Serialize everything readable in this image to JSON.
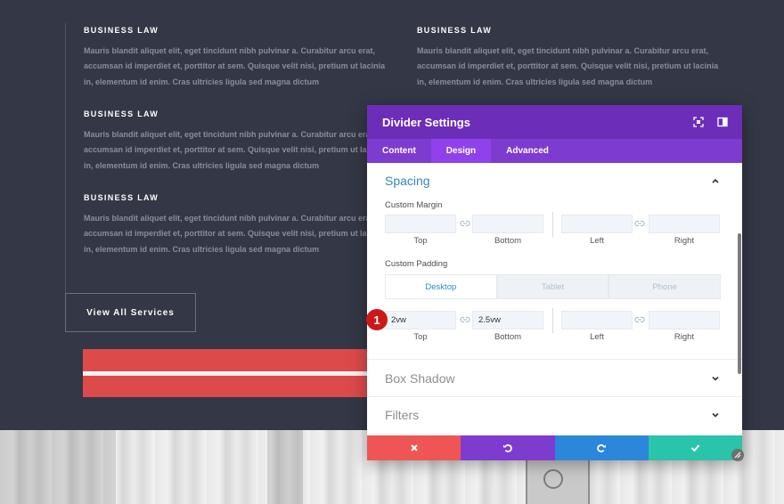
{
  "services": [
    {
      "title": "BUSINESS LAW",
      "text": "Mauris blandit aliquet elit, eget tincidunt nibh pulvinar a. Curabitur arcu erat, accumsan id imperdiet et, porttitor at sem. Quisque velit nisi, pretium ut lacinia in, elementum id enim. Cras ultricies ligula sed magna dictum"
    },
    {
      "title": "BUSINESS LAW",
      "text": "Mauris blandit aliquet elit, eget tincidunt nibh pulvinar a. Curabitur arcu erat, accumsan id imperdiet et, porttitor at sem. Quisque velit nisi, pretium ut lacinia in, elementum id enim. Cras ultricies ligula sed magna dictum"
    },
    {
      "title": "BUSINESS LAW",
      "text": "Mauris blandit aliquet elit, eget tincidunt nibh pulvinar a. Curabitur arcu erat, accumsan id imperdiet et, porttitor at sem. Quisque velit nisi, pretium ut lacinia in, elementum id enim. Cras ultricies ligula sed magna dictum"
    },
    {
      "title": "BUSINESS LAW",
      "text": "Mauris blandit aliquet elit, eget tincidunt nibh pulvinar a. Curabitur arcu erat, accumsan id imperdiet et, porttitor at sem. Quisque velit nisi, pretium ut lacinia in, elementum id enim. Cras ultricies ligula sed magna dictum"
    }
  ],
  "view_all_label": "View All Services",
  "modal": {
    "title": "Divider Settings",
    "tabs": [
      "Content",
      "Design",
      "Advanced"
    ],
    "active_tab": "Design",
    "spacing": {
      "heading": "Spacing",
      "custom_margin_label": "Custom Margin",
      "custom_padding_label": "Custom Padding",
      "device_tabs": [
        "Desktop",
        "Tablet",
        "Phone"
      ],
      "active_device": "Desktop",
      "captions": {
        "top": "Top",
        "bottom": "Bottom",
        "left": "Left",
        "right": "Right"
      },
      "margin": {
        "top": "",
        "bottom": "",
        "left": "",
        "right": ""
      },
      "padding": {
        "top": "2vw",
        "bottom": "2.5vw",
        "left": "",
        "right": ""
      }
    },
    "box_shadow_heading": "Box Shadow",
    "filters_heading": "Filters",
    "footer_buttons": [
      {
        "name": "cancel",
        "icon": "close-icon",
        "color": "#ef5555"
      },
      {
        "name": "undo",
        "icon": "undo-icon",
        "color": "#7e3bd0"
      },
      {
        "name": "redo",
        "icon": "redo-icon",
        "color": "#2b87da"
      },
      {
        "name": "save",
        "icon": "check-icon",
        "color": "#29c4a9"
      }
    ]
  },
  "annotation_badge": "1",
  "colors": {
    "page_bg": "#343745",
    "header_purple": "#6c2eb9",
    "tab_purple": "#7e3bd0",
    "accent_blue": "#2e8ab8",
    "red_bar": "#dc4a4a"
  }
}
